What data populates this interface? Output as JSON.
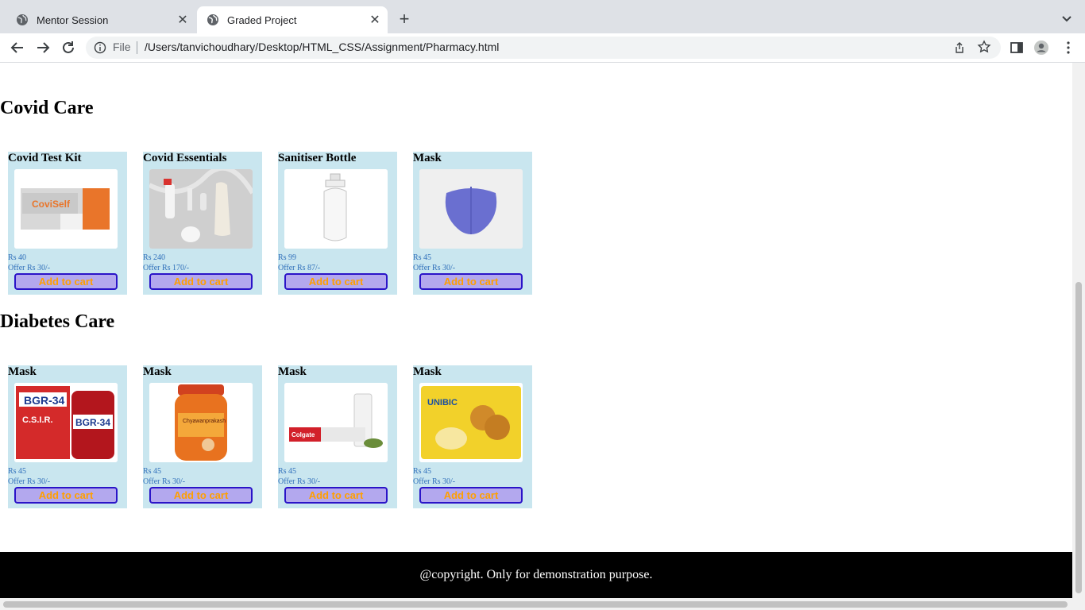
{
  "browser": {
    "tabs": [
      {
        "title": "Mentor Session",
        "active": false
      },
      {
        "title": "Graded Project",
        "active": true
      }
    ],
    "omnibox": {
      "scheme_label": "File",
      "url": "/Users/tanvichoudhary/Desktop/HTML_CSS/Assignment/Pharmacy.html"
    },
    "colors": {
      "tabbar": "#dee1e6",
      "omnibox": "#f1f3f4"
    }
  },
  "page": {
    "sections": [
      {
        "title": "Covid Care",
        "products": [
          {
            "name": "Covid Test Kit",
            "price": "Rs 40",
            "offer": "Offer Rs 30/-",
            "button": "Add to cart",
            "image": "covid-test-kit-box"
          },
          {
            "name": "Covid Essentials",
            "price": "Rs 240",
            "offer": "Offer Rs 170/-",
            "button": "Add to cart",
            "image": "covid-essentials-kit"
          },
          {
            "name": "Sanitiser Bottle",
            "price": "Rs 99",
            "offer": "Offer Rs 87/-",
            "button": "Add to cart",
            "image": "sanitiser-spray-bottle"
          },
          {
            "name": "Mask",
            "price": "Rs 45",
            "offer": "Offer Rs 30/-",
            "button": "Add to cart",
            "image": "blue-cloth-mask"
          }
        ]
      },
      {
        "title": "Diabetes Care",
        "products": [
          {
            "name": "Mask",
            "price": "Rs 45",
            "offer": "Offer Rs 30/-",
            "button": "Add to cart",
            "image": "bgr-34-pack"
          },
          {
            "name": "Mask",
            "price": "Rs 45",
            "offer": "Offer Rs 30/-",
            "button": "Add to cart",
            "image": "chyawanprakash-jar"
          },
          {
            "name": "Mask",
            "price": "Rs 45",
            "offer": "Offer Rs 30/-",
            "button": "Add to cart",
            "image": "colgate-diabetes-toothpaste"
          },
          {
            "name": "Mask",
            "price": "Rs 45",
            "offer": "Offer Rs 30/-",
            "button": "Add to cart",
            "image": "unibic-cookies-pack"
          }
        ]
      }
    ],
    "footer": "@copyright. Only for demonstration purpose.",
    "colors": {
      "card_bg": "#c9e6ef",
      "button_bg": "#b3a8ee",
      "button_border": "#2a14c8",
      "button_text": "#ff9f00",
      "price_text": "#2f6fba",
      "footer_bg": "#000000"
    }
  }
}
